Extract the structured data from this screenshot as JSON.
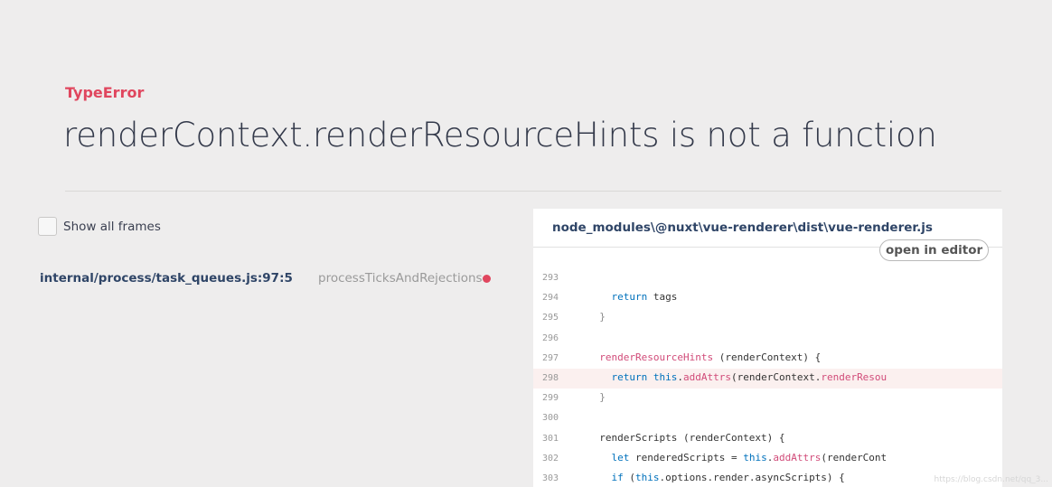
{
  "error": {
    "type": "TypeError",
    "message": "renderContext.renderResourceHints is not a function"
  },
  "frames_toggle": {
    "label": "Show all frames",
    "checked": false
  },
  "frames": [
    {
      "file": "internal/process/task_queues.js:97:5",
      "function": "processTicksAndRejections"
    }
  ],
  "code_view": {
    "filename": "node_modules\\@nuxt\\vue-renderer\\dist\\vue-renderer.js",
    "open_editor_label": "open in editor",
    "highlight_line": "298",
    "lines": [
      {
        "number": "293",
        "code": ""
      },
      {
        "number": "294",
        "code": "    return tags"
      },
      {
        "number": "295",
        "code": "  }"
      },
      {
        "number": "296",
        "code": ""
      },
      {
        "number": "297",
        "code": "  renderResourceHints (renderContext) {"
      },
      {
        "number": "298",
        "code": "    return this.addAttrs(renderContext.renderResou"
      },
      {
        "number": "299",
        "code": "  }"
      },
      {
        "number": "300",
        "code": ""
      },
      {
        "number": "301",
        "code": "  renderScripts (renderContext) {"
      },
      {
        "number": "302",
        "code": "    let renderedScripts = this.addAttrs(renderCont"
      },
      {
        "number": "303",
        "code": "    if (this.options.render.asyncScripts) {"
      }
    ]
  },
  "watermark": "https://blog.csdn.net/qq_3..."
}
